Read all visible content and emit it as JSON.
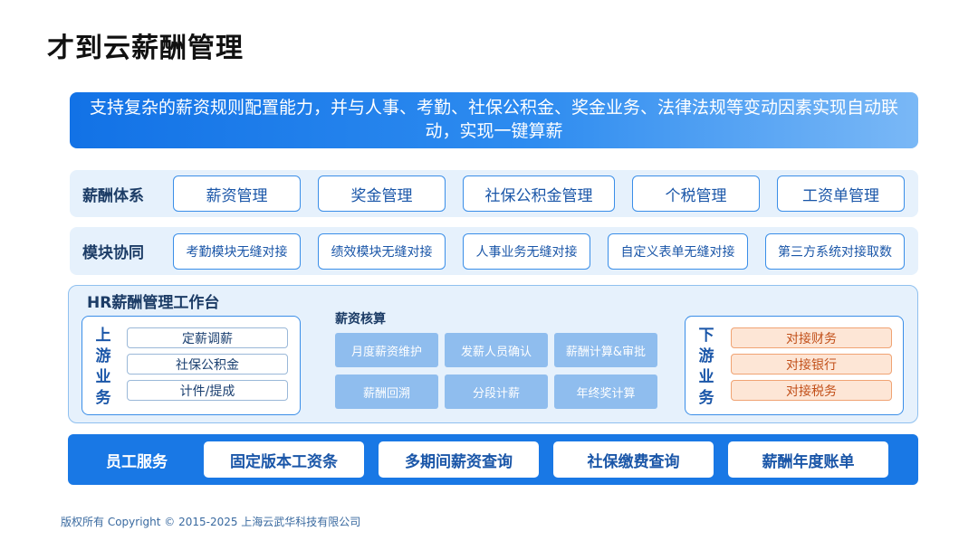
{
  "title": "才到云薪酬管理",
  "banner": "支持复杂的薪资规则配置能力，并与人事、考勤、社保公积金、奖金业务、法律法规等变动因素实现自动联动，实现一键算薪",
  "system": {
    "label": "薪酬体系",
    "items": [
      "薪资管理",
      "奖金管理",
      "社保公积金管理",
      "个税管理",
      "工资单管理"
    ]
  },
  "modules": {
    "label": "模块协同",
    "items": [
      "考勤模块无缝对接",
      "绩效模块无缝对接",
      "人事业务无缝对接",
      "自定义表单无缝对接",
      "第三方系统对接取数"
    ]
  },
  "workbench": {
    "title": "HR薪酬管理工作台",
    "upstream": {
      "label": [
        "上",
        "游",
        "业",
        "务"
      ],
      "items": [
        "定薪调薪",
        "社保公积金",
        "计件/提成"
      ]
    },
    "calc": {
      "title": "薪资核算",
      "items": [
        "月度薪资维护",
        "发薪人员确认",
        "薪酬计算&审批",
        "薪酬回溯",
        "分段计薪",
        "年终奖计算"
      ]
    },
    "downstream": {
      "label": [
        "下",
        "游",
        "业",
        "务"
      ],
      "items": [
        "对接财务",
        "对接银行",
        "对接税务"
      ]
    }
  },
  "service": {
    "label": "员工服务",
    "items": [
      "固定版本工资条",
      "多期间薪资查询",
      "社保缴费查询",
      "薪酬年度账单"
    ]
  },
  "footer": "版权所有 Copyright © 2015-2025 上海云武华科技有限公司",
  "colors": {
    "primary": "#1978e5",
    "panel": "#e6f1fc",
    "orange": "#fde6d6"
  }
}
